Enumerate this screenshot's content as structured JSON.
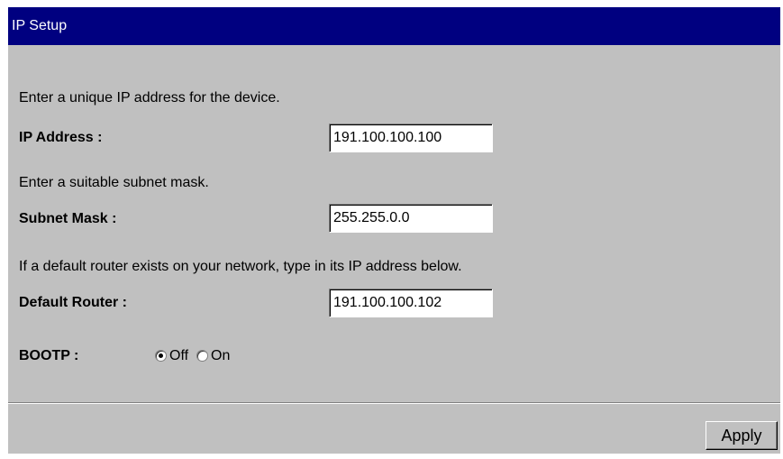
{
  "window": {
    "title": "IP Setup"
  },
  "ip_address": {
    "instruction": "Enter a unique IP address for the device.",
    "label": "IP Address :",
    "value": "191.100.100.100"
  },
  "subnet_mask": {
    "instruction": "Enter a suitable subnet mask.",
    "label": "Subnet Mask :",
    "value": "255.255.0.0"
  },
  "default_router": {
    "instruction": "If a default router exists on your network, type in its IP address below.",
    "label": "Default Router :",
    "value": "191.100.100.102"
  },
  "bootp": {
    "label": "BOOTP :",
    "options": [
      {
        "label": "Off",
        "selected": true
      },
      {
        "label": "On",
        "selected": false
      }
    ]
  },
  "actions": {
    "apply_label": "Apply"
  },
  "colors": {
    "title_bar": "#000080",
    "panel_background": "#c0c0c0"
  }
}
